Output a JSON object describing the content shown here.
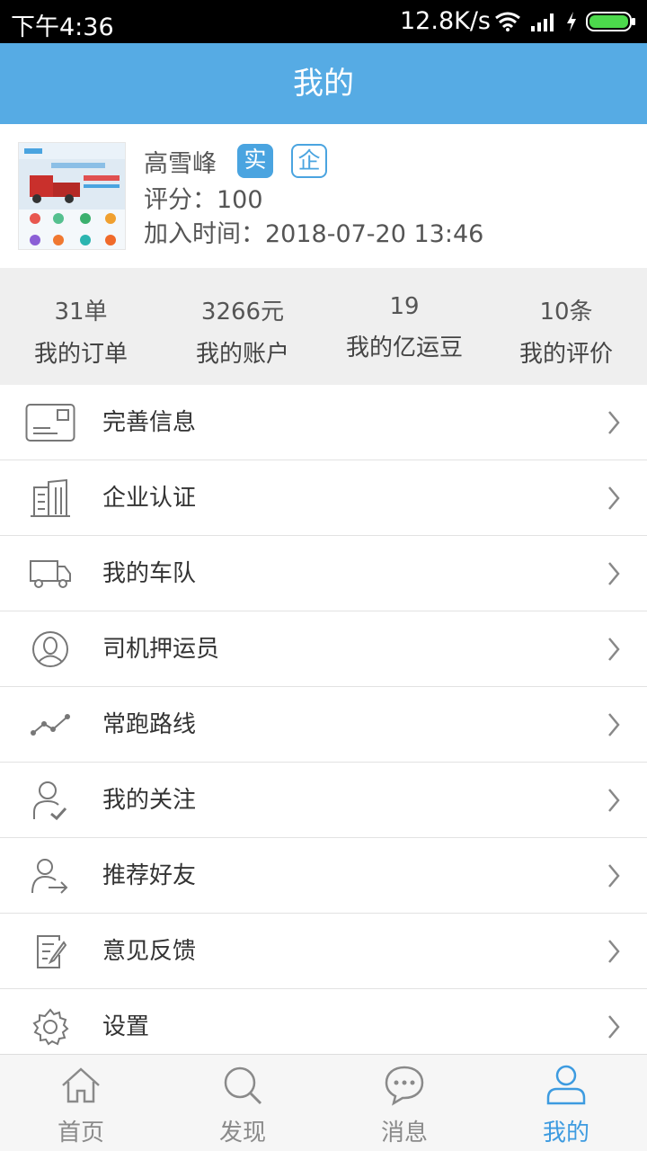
{
  "status_bar": {
    "time": "下午4:36",
    "net_speed": "12.8K/s",
    "icons": [
      "wifi-icon",
      "signal-icon",
      "charging-icon",
      "battery-icon"
    ]
  },
  "header": {
    "title": "我的"
  },
  "profile": {
    "name": "高雪峰",
    "badge_real": "实",
    "badge_enterprise": "企",
    "score": "评分：100",
    "join_time": "加入时间：2018-07-20 13:46"
  },
  "stats": [
    {
      "value": "31单",
      "label": "我的订单"
    },
    {
      "value": "3266元",
      "label": "我的账户"
    },
    {
      "value": "19",
      "label": "我的亿运豆"
    },
    {
      "value": "10条",
      "label": "我的评价"
    }
  ],
  "menu": [
    {
      "label": "完善信息",
      "icon": "id-card-icon"
    },
    {
      "label": "企业认证",
      "icon": "building-icon"
    },
    {
      "label": "我的车队",
      "icon": "truck-icon"
    },
    {
      "label": "司机押运员",
      "icon": "driver-icon"
    },
    {
      "label": "常跑路线",
      "icon": "route-icon"
    },
    {
      "label": "我的关注",
      "icon": "follow-icon"
    },
    {
      "label": "推荐好友",
      "icon": "recommend-icon"
    },
    {
      "label": "意见反馈",
      "icon": "feedback-icon"
    },
    {
      "label": "设置",
      "icon": "settings-icon"
    }
  ],
  "tabs": [
    {
      "label": "首页",
      "icon": "home-icon"
    },
    {
      "label": "发现",
      "icon": "search-icon"
    },
    {
      "label": "消息",
      "icon": "message-icon"
    },
    {
      "label": "我的",
      "icon": "profile-icon"
    }
  ],
  "colors": {
    "header_bg": "#56abe4",
    "accent": "#3d9be0",
    "badge_real_bg": "#4aa4e0",
    "stats_bg": "#efefef",
    "tabbar_bg": "#f6f6f6"
  }
}
